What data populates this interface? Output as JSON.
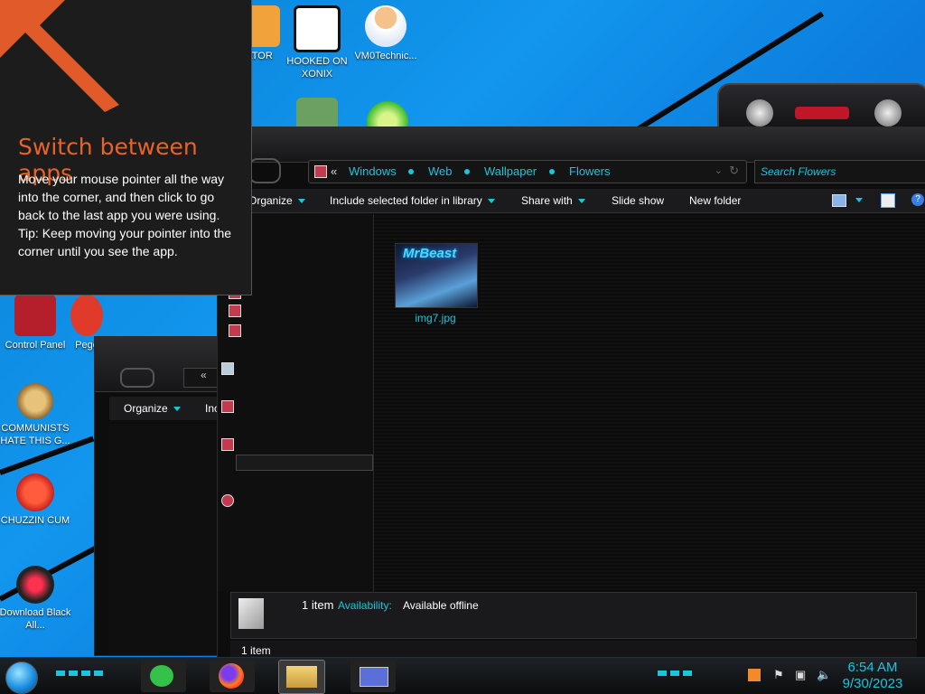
{
  "tip": {
    "title": "Switch between apps",
    "body": "Move your mouse pointer all the way into the corner, and then click to go back to the last app you were using.",
    "hint": "Tip: Keep moving your pointer into the corner until you see the app."
  },
  "desktop_icons": [
    {
      "label": "ATOR",
      "icon": "app-icon"
    },
    {
      "label": "HOOKED ON XONIX",
      "icon": "game-icon"
    },
    {
      "label": "VM0Technic...",
      "icon": "doctor-icon"
    },
    {
      "label": "Control Panel",
      "icon": "control-panel-icon"
    },
    {
      "label": "Pego",
      "icon": "parrot-icon"
    },
    {
      "label": "COMMUNISTS HATE THIS G...",
      "icon": "money-bag-icon"
    },
    {
      "label": "CHUZZIN CUM",
      "icon": "chuzzle-icon"
    },
    {
      "label": "Download Black All...",
      "icon": "alien-icon"
    }
  ],
  "explorer": {
    "breadcrumb": [
      "Windows",
      "Web",
      "Wallpaper",
      "Flowers"
    ],
    "breadcrumb_prefix": "«",
    "search_placeholder": "Search Flowers",
    "toolbar": {
      "organize": "Organize",
      "include": "Include selected folder in library",
      "share": "Share with",
      "slideshow": "Slide show",
      "new_folder": "New folder"
    },
    "file": {
      "name": "img7.jpg",
      "thumb_title": "MrBeast"
    },
    "details": {
      "count": "1 item",
      "availability_label": "Availability:",
      "availability_value": "Available offline"
    },
    "status": "1 item"
  },
  "back_window": {
    "breadcrumb_prefix": "«",
    "organize": "Organize",
    "include_short": "Inc"
  },
  "taskbar": {
    "time": "6:54 AM",
    "date": "9/30/2023"
  },
  "colors": {
    "accent": "#19c6dc",
    "tip_title": "#e8622a",
    "desktop": "#1296ee"
  }
}
